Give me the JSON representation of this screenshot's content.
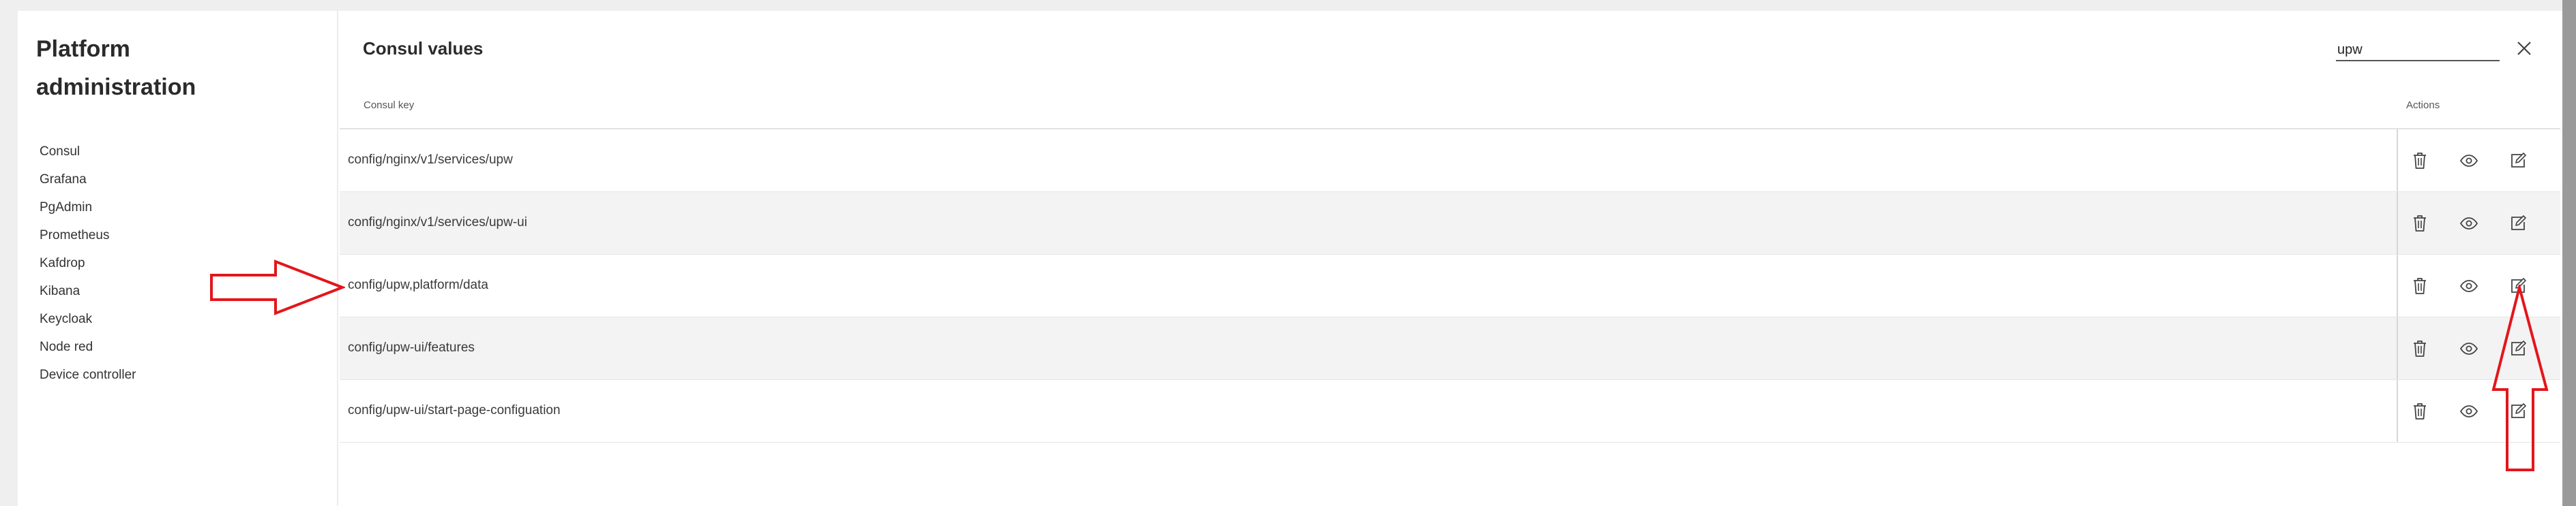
{
  "sidebar": {
    "title": "Platform administration",
    "items": [
      {
        "label": "Consul"
      },
      {
        "label": "Grafana"
      },
      {
        "label": "PgAdmin"
      },
      {
        "label": "Prometheus"
      },
      {
        "label": "Kafdrop"
      },
      {
        "label": "Kibana"
      },
      {
        "label": "Keycloak"
      },
      {
        "label": "Node red"
      },
      {
        "label": "Device controller"
      }
    ]
  },
  "main": {
    "title": "Consul values",
    "search": {
      "value": "upw",
      "placeholder": ""
    },
    "table": {
      "headers": {
        "key": "Consul key",
        "actions": "Actions"
      },
      "rows": [
        {
          "key": "config/nginx/v1/services/upw"
        },
        {
          "key": "config/nginx/v1/services/upw-ui"
        },
        {
          "key": "config/upw,platform/data"
        },
        {
          "key": "config/upw-ui/features"
        },
        {
          "key": "config/upw-ui/start-page-configuation"
        }
      ]
    }
  },
  "icons": {
    "close": "close-icon",
    "delete": "trash-icon",
    "view": "eye-icon",
    "edit": "edit-icon"
  },
  "colors": {
    "annotation": "#e3161b",
    "stripe": "#f3f3f3"
  }
}
